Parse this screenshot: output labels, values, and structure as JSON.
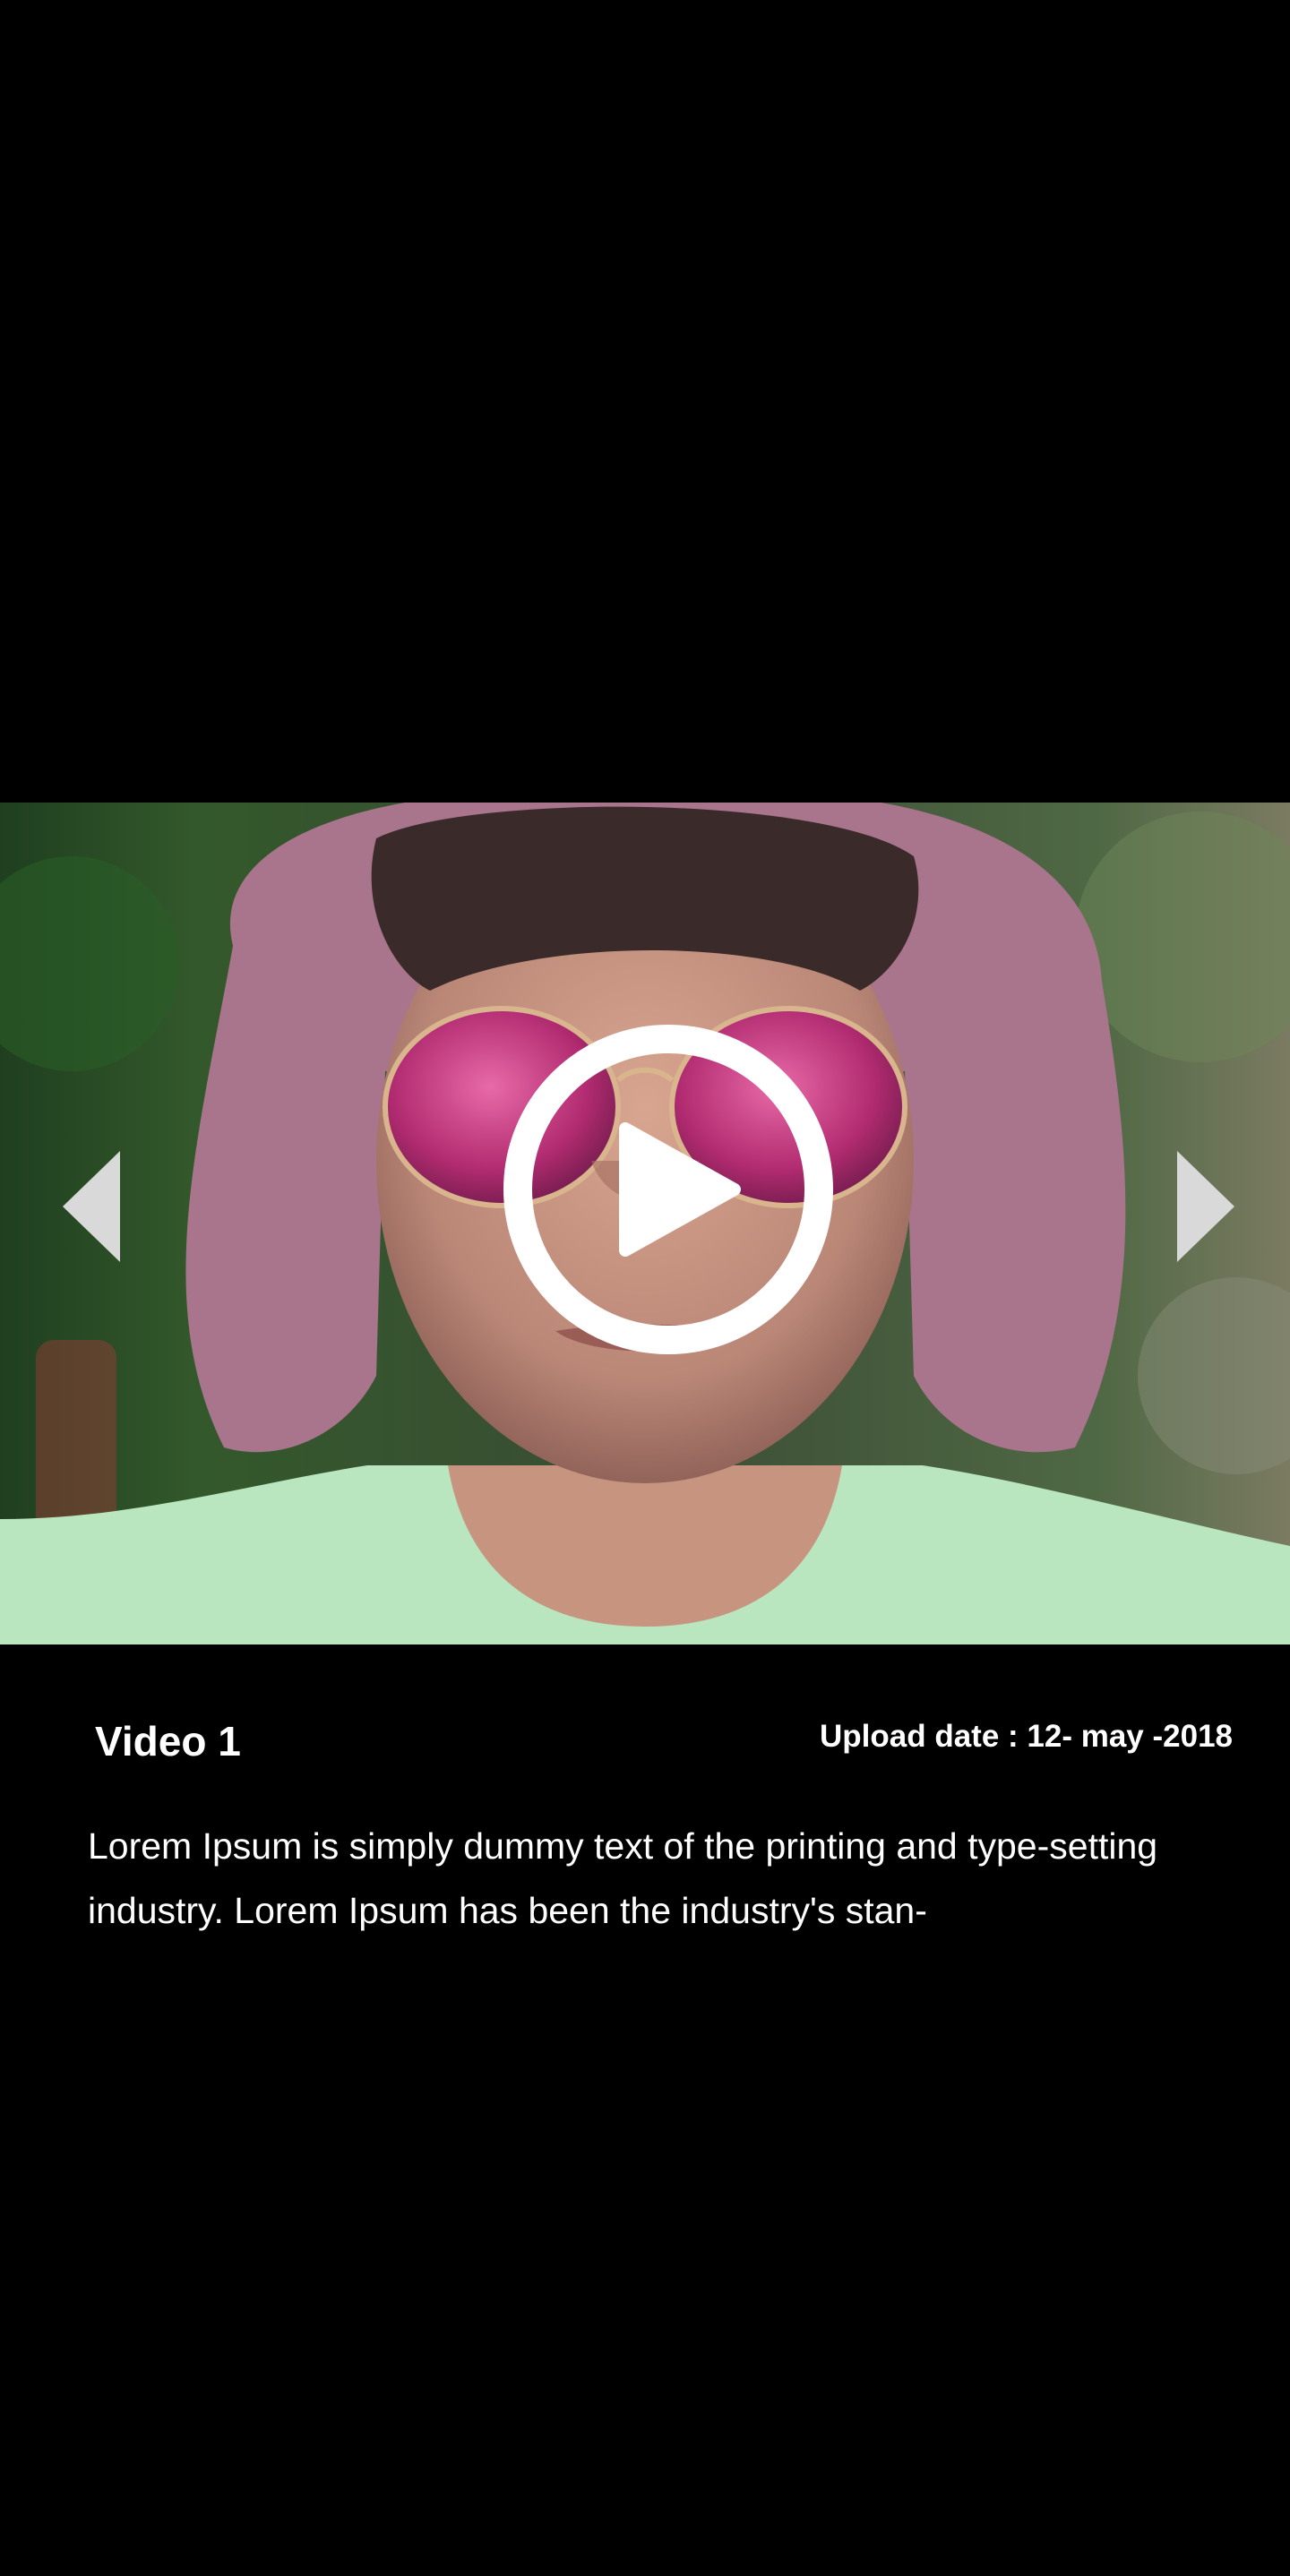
{
  "player": {
    "thumbnail_subject": "portrait-with-pink-hair-and-mirrored-sunglasses",
    "play_icon": "play-circle-icon",
    "prev_icon": "chevron-left-icon",
    "next_icon": "chevron-right-icon"
  },
  "video": {
    "title": "Video 1",
    "upload_date": "Upload date : 12- may -2018",
    "description": "Lorem Ipsum is simply dummy text of the printing and type-setting industry. Lorem Ipsum has been the industry's stan-"
  },
  "colors": {
    "background": "#000000",
    "text": "#ffffff",
    "arrow": "#d9d9d9"
  }
}
